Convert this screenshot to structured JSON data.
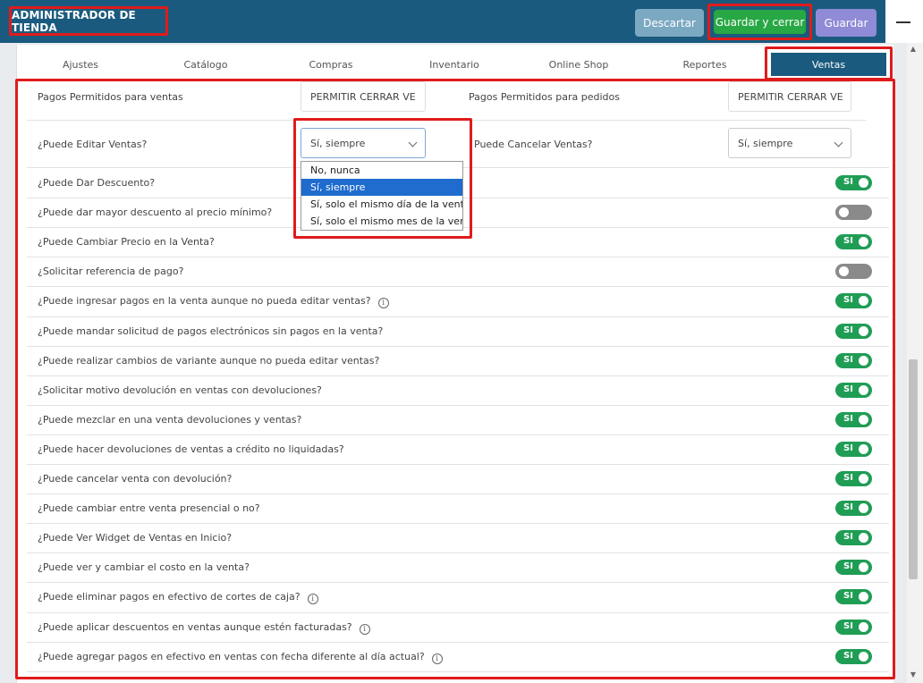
{
  "header": {
    "title": "ADMINISTRADOR DE TIENDA",
    "discard_label": "Descartar",
    "save_close_label": "Guardar y cerrar",
    "save_label": "Guardar"
  },
  "tabs": [
    {
      "label": "Ajustes"
    },
    {
      "label": "Catálogo"
    },
    {
      "label": "Compras"
    },
    {
      "label": "Inventario"
    },
    {
      "label": "Online Shop"
    },
    {
      "label": "Reportes"
    },
    {
      "label": "Ventas",
      "active": true
    }
  ],
  "fields": {
    "pagos_ventas_label": "Pagos Permitidos para ventas",
    "pagos_ventas_value": "PERMITIR CERRAR VE",
    "pagos_pedidos_label": "Pagos Permitidos para pedidos",
    "pagos_pedidos_value": "PERMITIR CERRAR VE",
    "editar_label": "¿Puede Editar Ventas?",
    "editar_value": "Sí, siempre",
    "cancelar_label": "Puede Cancelar Ventas?",
    "cancelar_value": "Sí, siempre"
  },
  "dropdown_options": [
    {
      "label": "No, nunca"
    },
    {
      "label": "Sí, siempre",
      "selected": true
    },
    {
      "label": "Sí, solo el mismo día de la venta"
    },
    {
      "label": "Sí, solo el mismo mes de la venta"
    }
  ],
  "toggle_on_label": "SI",
  "settings": [
    {
      "label": "¿Puede Dar Descuento?",
      "on": true,
      "info": false
    },
    {
      "label": "¿Puede dar mayor descuento al precio mínimo?",
      "on": false,
      "info": false
    },
    {
      "label": "¿Puede Cambiar Precio en la Venta?",
      "on": true,
      "info": false
    },
    {
      "label": "¿Solicitar referencia de pago?",
      "on": false,
      "info": false
    },
    {
      "label": "¿Puede ingresar pagos en la venta aunque no pueda editar ventas?",
      "on": true,
      "info": true
    },
    {
      "label": "¿Puede mandar solicitud de pagos electrónicos sin pagos en la venta?",
      "on": true,
      "info": false
    },
    {
      "label": "¿Puede realizar cambios de variante aunque no pueda editar ventas?",
      "on": true,
      "info": false
    },
    {
      "label": "¿Solicitar motivo devolución en ventas con devoluciones?",
      "on": true,
      "info": false
    },
    {
      "label": "¿Puede mezclar en una venta devoluciones y ventas?",
      "on": true,
      "info": false
    },
    {
      "label": "¿Puede hacer devoluciones de ventas a crédito no liquidadas?",
      "on": true,
      "info": false
    },
    {
      "label": "¿Puede cancelar venta con devolución?",
      "on": true,
      "info": false
    },
    {
      "label": "¿Puede cambiar entre venta presencial o no?",
      "on": true,
      "info": false
    },
    {
      "label": "¿Puede Ver Widget de Ventas en Inicio?",
      "on": true,
      "info": false
    },
    {
      "label": "¿Puede ver y cambiar el costo en la venta?",
      "on": true,
      "info": false
    },
    {
      "label": "¿Puede eliminar pagos en efectivo de cortes de caja?",
      "on": true,
      "info": true
    },
    {
      "label": "¿Puede aplicar descuentos en ventas aunque estén facturadas?",
      "on": true,
      "info": true
    },
    {
      "label": "¿Puede agregar pagos en efectivo en ventas con fecha diferente al día actual?",
      "on": true,
      "info": true
    }
  ]
}
